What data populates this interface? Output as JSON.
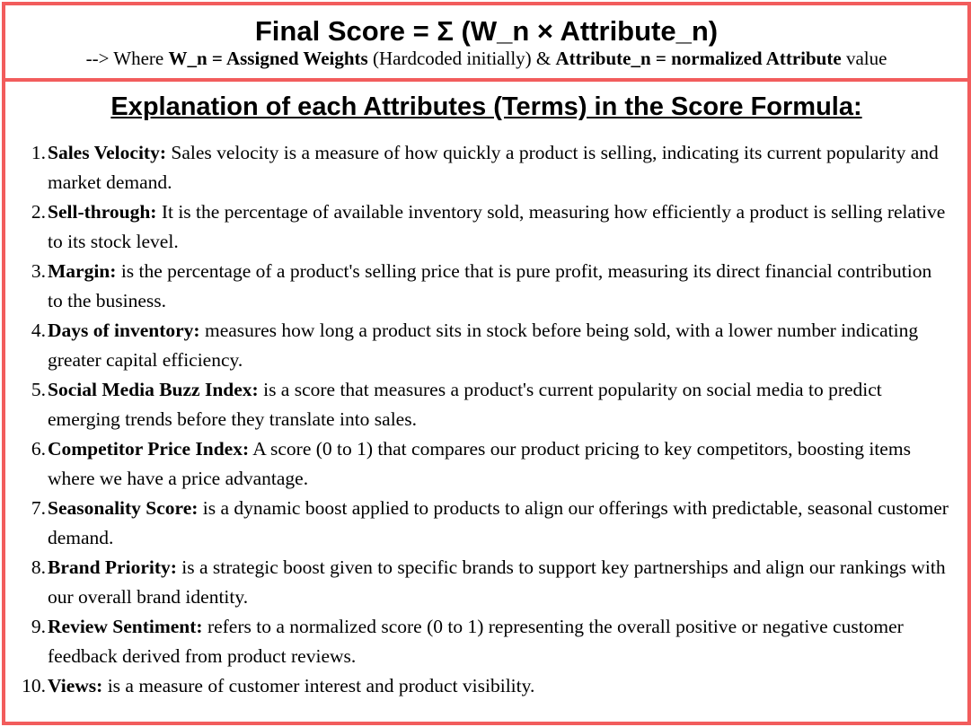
{
  "formula": {
    "title": "Final Score = Σ (W_n × Attribute_n)",
    "sub_prefix": "--> Where ",
    "sub_weights_bold": "W_n = Assigned Weights",
    "sub_middle": " (Hardcoded initially) & ",
    "sub_attr_bold": "Attribute_n = normalized Attribute",
    "sub_suffix": " value"
  },
  "explanation": {
    "heading": "Explanation of each Attributes (Terms) in the Score Formula:",
    "items": [
      {
        "num": "1.",
        "name": "Sales Velocity:",
        "desc": " Sales velocity is a measure of how quickly a product is selling, indicating its current popularity and market demand."
      },
      {
        "num": "2.",
        "name": "Sell-through:",
        "desc": " It is the percentage of available inventory sold, measuring how efficiently a product is selling relative to its stock level."
      },
      {
        "num": "3.",
        "name": "Margin:",
        "desc": " is the percentage of a product's selling price that is pure profit, measuring its direct financial contribution to the business."
      },
      {
        "num": "4.",
        "name": "Days of inventory:",
        "desc": " measures how long a product sits in stock before being sold, with a lower number indicating greater capital efficiency."
      },
      {
        "num": "5.",
        "name": "Social Media Buzz Index:",
        "desc": " is a score that measures a product's current popularity on social media to predict emerging trends before they translate into sales."
      },
      {
        "num": "6.",
        "name": "Competitor Price Index:",
        "desc": " A score (0 to 1) that compares our product pricing to key competitors, boosting items where we have a price advantage."
      },
      {
        "num": "7.",
        "name": "Seasonality Score:",
        "desc": " is a dynamic boost applied to products to align our offerings with predictable, seasonal customer demand."
      },
      {
        "num": "8.",
        "name": "Brand Priority:",
        "desc": " is a strategic boost given to specific brands to support key partnerships and align our rankings with our overall brand identity."
      },
      {
        "num": "9.",
        "name": "Review Sentiment:",
        "desc": " refers to a normalized score (0 to 1) representing the overall positive or negative customer feedback derived from product reviews."
      },
      {
        "num": "10.",
        "name": "Views:",
        "desc": " is a measure of customer interest and product visibility."
      }
    ]
  },
  "colors": {
    "border": "#f25c5c"
  }
}
